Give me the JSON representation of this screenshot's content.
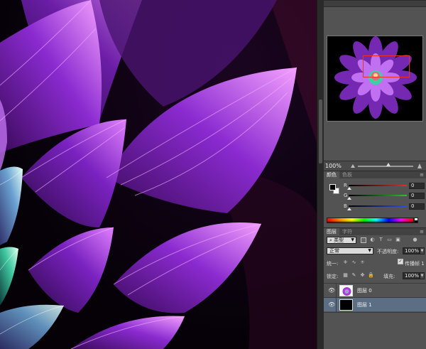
{
  "navigator": {
    "zoom": "100%"
  },
  "color_panel": {
    "tabs": [
      "颜色",
      "色板"
    ],
    "channels": [
      {
        "label": "R",
        "value": "0",
        "color": "#e03030"
      },
      {
        "label": "G",
        "value": "0",
        "color": "#30c030"
      },
      {
        "label": "B",
        "value": "0",
        "color": "#3050e0"
      }
    ],
    "foreground": "#000000",
    "background": "#ffffff"
  },
  "layers_panel": {
    "tabs": [
      "图层",
      "字符"
    ],
    "filter_kind": "类型",
    "blend_mode": "正常",
    "opacity_label": "不透明度:",
    "opacity_value": "100%",
    "unify_label": "统一:",
    "propagate_label": "传播帧 1",
    "lock_label": "锁定:",
    "fill_label": "填充:",
    "fill_value": "100%",
    "layers": [
      {
        "name": "图层 0",
        "selected": false
      },
      {
        "name": "图层 1",
        "selected": true
      }
    ]
  }
}
